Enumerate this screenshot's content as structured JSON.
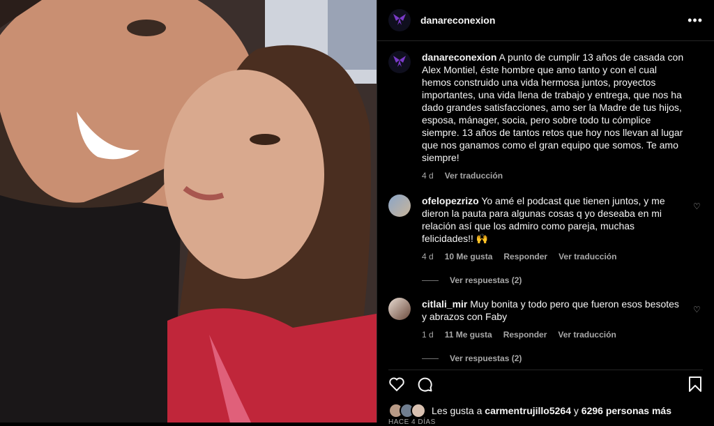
{
  "header": {
    "username": "danareconexion",
    "more_icon": "more-icon"
  },
  "caption": {
    "username": "danareconexion",
    "text": "A punto de cumplir 13 años de casada con Alex Montiel, éste hombre que amo tanto y con el cual hemos construido una vida hermosa juntos, proyectos importantes, una vida llena de trabajo y entrega, que nos ha dado grandes satisfacciones, amo ser la Madre de tus hijos, esposa, mánager, socia, pero sobre todo tu cómplice siempre. 13 años de tantos retos que hoy nos llevan al lugar que nos ganamos como el gran equipo que somos. Te amo siempre!",
    "time": "4 d",
    "translate": "Ver traducción"
  },
  "comments": [
    {
      "username": "ofelopezrizo",
      "text": "Yo amé el podcast que tienen juntos, y me dieron la pauta para algunas cosas q yo deseaba en mi relación así que los admiro como pareja, muchas felicidades!! 🙌",
      "time": "4 d",
      "likes": "10 Me gusta",
      "reply": "Responder",
      "translate": "Ver traducción",
      "view_replies": "Ver respuestas (2)"
    },
    {
      "username": "citlali_mir",
      "text": "Muy bonita y todo pero que fueron esos besotes y abrazos con Faby",
      "time": "1 d",
      "likes": "11 Me gusta",
      "reply": "Responder",
      "translate": "Ver traducción",
      "view_replies": "Ver respuestas (2)"
    }
  ],
  "likes": {
    "prefix": "Les gusta a ",
    "user": "carmentrujillo5264",
    "middle": " y ",
    "count": "6296 personas más"
  },
  "timestamp": "HACE 4 DÍAS",
  "colors": {
    "background": "#000000",
    "text": "#f5f5f5",
    "muted": "#a8a8a8",
    "border": "#262626"
  }
}
